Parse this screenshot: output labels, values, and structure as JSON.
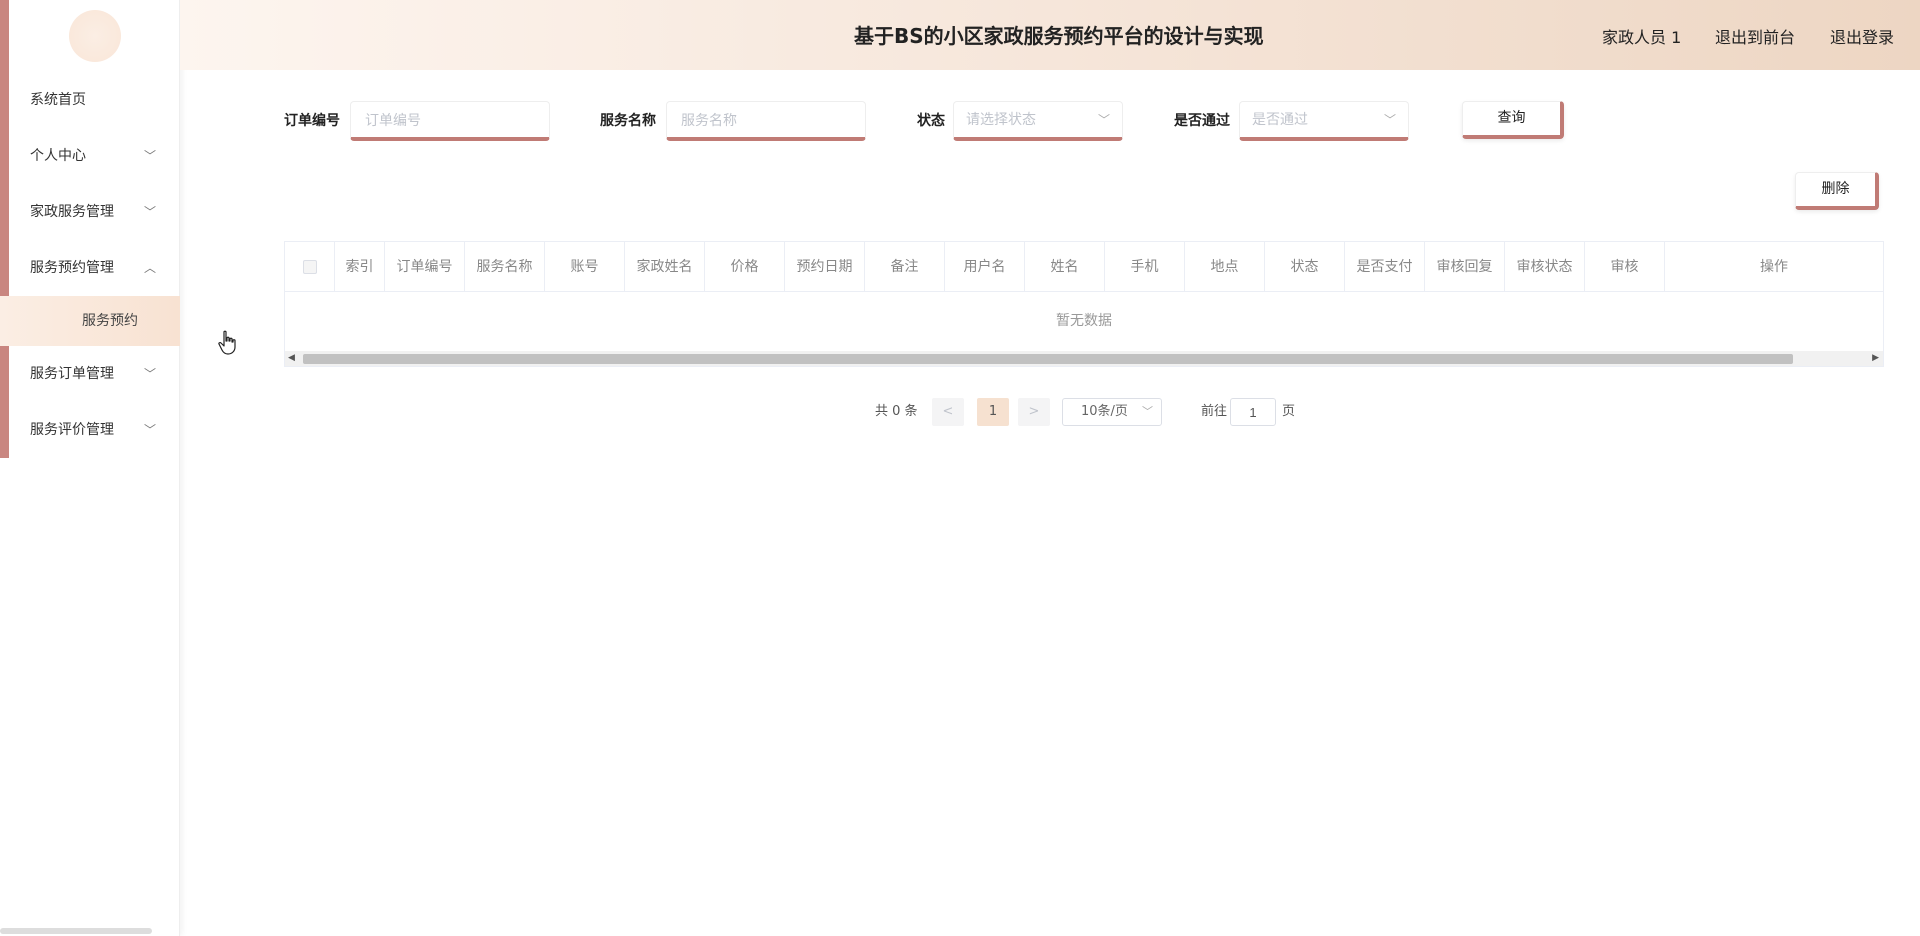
{
  "header": {
    "title": "基于BS的小区家政服务预约平台的设计与实现",
    "user": "家政人员 1",
    "back_to_front": "退出到前台",
    "logout": "退出登录"
  },
  "sidebar": {
    "items": [
      {
        "label": "系统首页"
      },
      {
        "label": "个人中心"
      },
      {
        "label": "家政服务管理"
      },
      {
        "label": "服务预约管理"
      },
      {
        "label": "服务订单管理"
      },
      {
        "label": "服务评价管理"
      }
    ],
    "subitem": "服务预约"
  },
  "search": {
    "order_no_label": "订单编号",
    "order_no_placeholder": "订单编号",
    "service_name_label": "服务名称",
    "service_name_placeholder": "服务名称",
    "status_label": "状态",
    "status_placeholder": "请选择状态",
    "passed_label": "是否通过",
    "passed_placeholder": "是否通过",
    "query_button": "查询"
  },
  "toolbar": {
    "delete_button": "删除"
  },
  "table": {
    "columns": [
      "索引",
      "订单编号",
      "服务名称",
      "账号",
      "家政姓名",
      "价格",
      "预约日期",
      "备注",
      "用户名",
      "姓名",
      "手机",
      "地点",
      "状态",
      "是否支付",
      "审核回复",
      "审核状态",
      "审核",
      "操作"
    ],
    "empty_text": "暂无数据"
  },
  "pagination": {
    "total_text": "共 0 条",
    "current_page": "1",
    "page_size": "10条/页",
    "goto_label": "前往",
    "goto_value": "1",
    "page_unit": "页"
  },
  "colors": {
    "accent": "#c07b75",
    "header_gradient_end": "#edd6c3",
    "active_page": "#f6e1d0"
  }
}
